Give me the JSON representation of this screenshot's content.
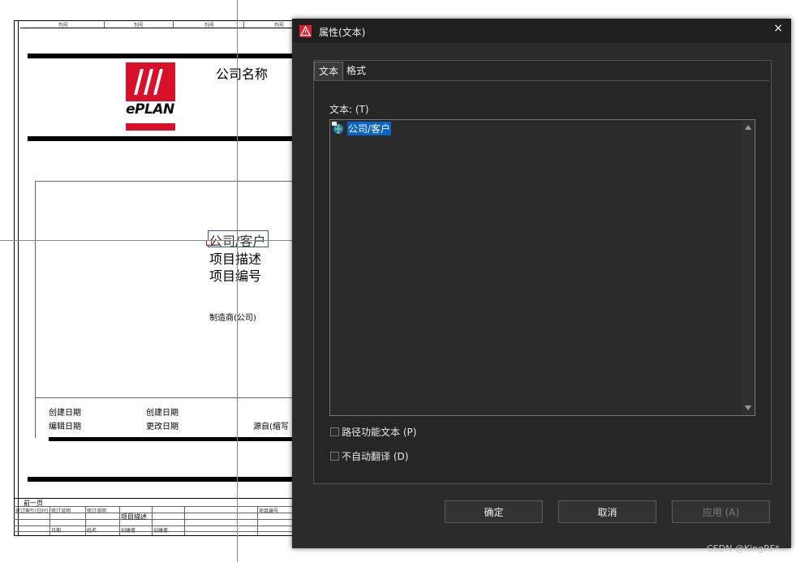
{
  "drawing": {
    "header_cells": [
      "列号",
      "列号",
      "列号",
      "列号"
    ],
    "company_name": "公司名称",
    "logo_text": "ePLAN",
    "customer_field": "公司/客户",
    "project_description": "项目描述",
    "project_number": "项目编号",
    "manufacturer": "制造商(公司)",
    "created_date_1": "创建日期",
    "created_date_2": "创建日期",
    "edit_date": "编辑日期",
    "modified_date": "更改日期",
    "source": "源自(缩写",
    "prev_page": "前一页",
    "tb_project_desc": "项目描述",
    "tb_small_texts": [
      "修订索引",
      "(日付)",
      "修订说明",
      "修订说明",
      "项目编号",
      "日期",
      "姓名",
      "创建者",
      "创建者"
    ]
  },
  "dialog": {
    "title": "属性(文本)",
    "close_icon": "×",
    "tabs": [
      "文本",
      "格式"
    ],
    "text_label": "文本: (T)",
    "text_value": "公司/客户",
    "checkbox_path": "路径功能文本 (P)",
    "checkbox_no_translate": "不自动翻译 (D)",
    "buttons": {
      "ok": "确定",
      "cancel": "取消",
      "apply": "应用 (A)"
    }
  },
  "watermark": "CSDN @KingRF*",
  "colors": {
    "dialog_bg": "#2b2b2b",
    "titlebar": "#1f1f1f",
    "selection": "#0a64c8",
    "eplan_red": "#d8102a",
    "warning_red": "#e2202e"
  }
}
